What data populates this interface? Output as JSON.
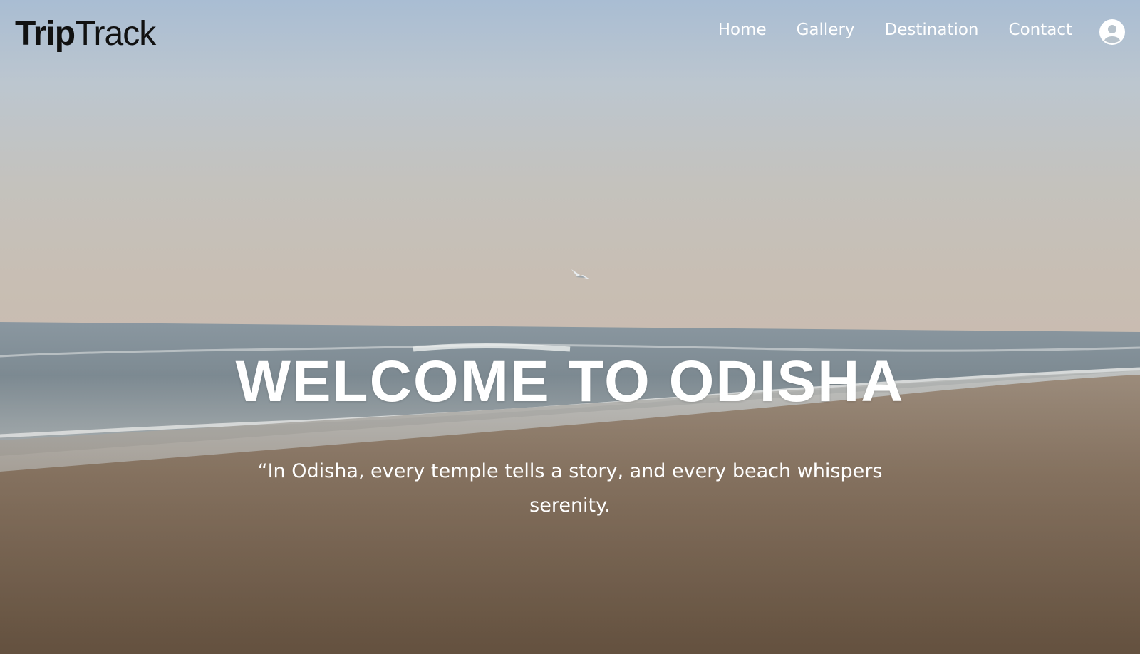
{
  "header": {
    "logo": {
      "bold": "Trip",
      "light": "Track"
    },
    "nav": [
      {
        "label": "Home"
      },
      {
        "label": "Gallery"
      },
      {
        "label": "Destination"
      },
      {
        "label": "Contact"
      }
    ],
    "account_icon": "user-circle-icon"
  },
  "hero": {
    "title": "WELCOME TO ODISHA",
    "quote": "“In Odisha, every temple tells a story, and every beach whispers serenity."
  },
  "colors": {
    "text_light": "#ffffff",
    "logo_text": "#111111"
  }
}
